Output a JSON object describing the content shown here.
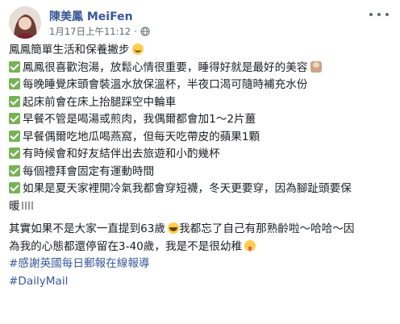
{
  "header": {
    "author": "陳美鳳 MeiFen",
    "timestamp": "1月17日上午11:12",
    "separator": "·",
    "audience_icon": "globe-icon",
    "menu_icon": "more-dots-icon"
  },
  "post": {
    "intro": "鳳鳳簡單生活和保養撇步",
    "items": [
      "鳳鳳很喜歡泡湯，放鬆心情很重要，睡得好就是最好的美容",
      "每晚睡覺床頭會裝溫水放保溫杯，半夜口渴可隨時補充水份",
      "起床前會在床上抬腿踩空中輪車",
      "早餐不管是喝湯或煎肉，我偶爾都會加1～2片薑",
      "早餐偶爾吃地瓜喝燕窩，但每天吃帶皮的蘋果1顆",
      "有時候會和好友結伴出去旅遊和小酌幾杯",
      "每個禮拜會固定有運動時間",
      "如果是夏天家裡開冷氣我都會穿短襪，冬天更要穿，因為腳趾頭要保",
      "暖"
    ],
    "closing_1": "其實如果不是大家一直提到63歲",
    "closing_2": "我都忘了自己有那熟齡啦～哈哈～因",
    "closing_3": "為我的心態都還停留在3-40歲，我是不是很幼稚",
    "hashtag_1": "#感謝英國每日郵報在線報導",
    "hashtag_2": "#DailyMail"
  },
  "colors": {
    "link": "#385898",
    "text": "#1c1e21",
    "meta": "#616770",
    "check": "#77b255"
  }
}
